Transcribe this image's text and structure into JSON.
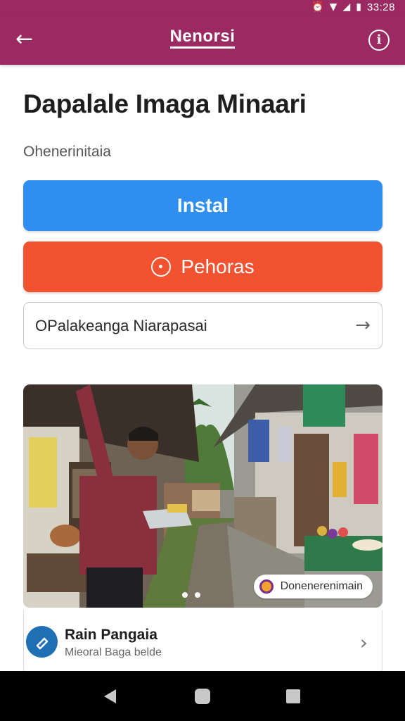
{
  "status_bar": {
    "time": "33:28"
  },
  "app_bar": {
    "title": "Nenorsi"
  },
  "page": {
    "heading": "Dapalale Imaga Minaari",
    "subtitle": "Ohenerinitaia"
  },
  "actions": {
    "install_label": "Instal",
    "pehoras_label": "Pehoras",
    "link_label": "OPalakeanga Niarapasai"
  },
  "photo": {
    "caption": "Donenerenimain",
    "pages": 2
  },
  "list_item": {
    "title": "Rain Pangaia",
    "subtitle": "Mieoral Baga belde"
  },
  "colors": {
    "app_bar": "#9c2a62",
    "install": "#2e8ff0",
    "pehoras": "#f2522f"
  }
}
